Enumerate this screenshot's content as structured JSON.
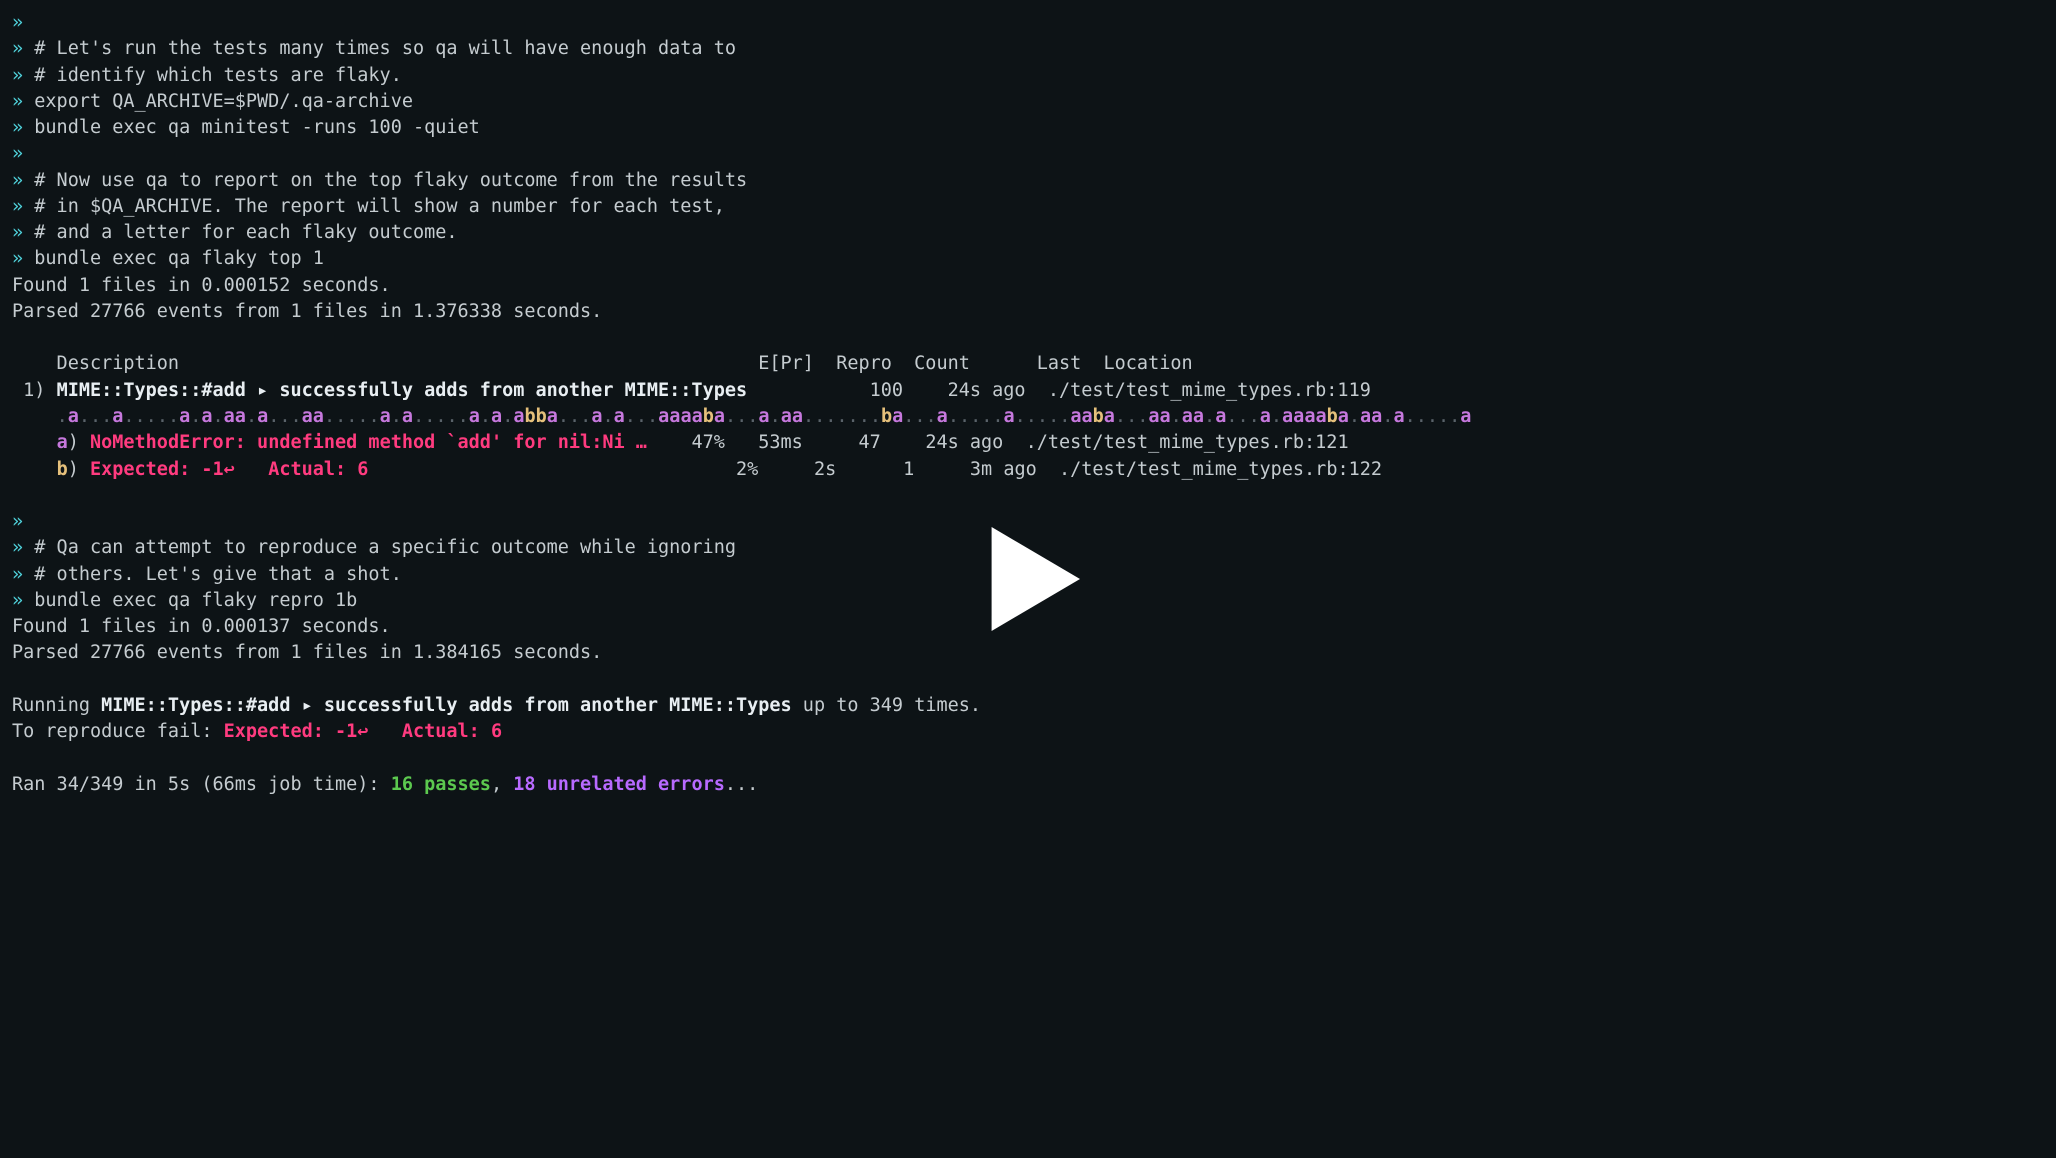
{
  "prompt": "»",
  "block1": {
    "blank0": "",
    "c1": "# Let's run the tests many times so qa will have enough data to",
    "c2": "# identify which tests are flaky.",
    "cmd1": "export QA_ARCHIVE=$PWD/.qa-archive",
    "cmd2": "bundle exec qa minitest -runs 100 -quiet",
    "blank1": "",
    "c3": "# Now use qa to report on the top flaky outcome from the results",
    "c4": "# in $QA_ARCHIVE. The report will show a number for each test,",
    "c5": "# and a letter for each flaky outcome.",
    "cmd3": "bundle exec qa flaky top 1"
  },
  "found1": "Found 1 files in 0.000152 seconds.",
  "parsed1": "Parsed 27766 events from 1 files in 1.376338 seconds.",
  "header": "    Description                                                    E[Pr]  Repro  Count      Last  Location",
  "row1": {
    "prefix": " 1) ",
    "desc": "MIME::Types::#add ▸ successfully adds from another MIME::Types",
    "tail": "           100    24s ago  ./test/test_mime_types.rb:119"
  },
  "pattern": {
    "pad": "    ",
    "segments": [
      ".",
      "a",
      ".",
      "..",
      "a",
      ".",
      "..",
      "..",
      "a",
      ".",
      "a",
      ".",
      "aa",
      ".",
      "a",
      ".",
      "..",
      "aa",
      ".",
      "..",
      "..",
      "a",
      ".",
      "a",
      ".",
      "..",
      "..",
      "a",
      ".",
      "a",
      ".",
      "ab",
      "ba",
      ".",
      "..",
      "a",
      ".",
      "a",
      ".",
      "..",
      "aa",
      "aa",
      "ba",
      ".",
      "..",
      "a",
      ".",
      "aa",
      ".",
      "..",
      "..",
      "..",
      "ba",
      ".",
      "..",
      "a",
      ".",
      "..",
      "..",
      "a",
      ".",
      "..",
      "..",
      "aa",
      "ba",
      ".",
      "..",
      "aa",
      ".",
      "aa",
      ".",
      "a",
      ".",
      "..",
      "a",
      ".",
      "aa",
      "aa",
      "ba",
      ".",
      "aa",
      ".",
      "a",
      ".",
      "..",
      "..",
      "a"
    ]
  },
  "rowA": {
    "pad": "    ",
    "label": "a",
    "sep": ") ",
    "msg": "NoMethodError: undefined method `add' for nil:Ni …",
    "tail": "    47%   53ms     47    24s ago  ./test/test_mime_types.rb:121"
  },
  "rowB": {
    "pad": "    ",
    "label": "b",
    "sep": ") ",
    "msg1": "Expected: -1↩",
    "gap": "   ",
    "msg2": "Actual: 6",
    "tail": "                                 2%     2s      1     3m ago  ./test/test_mime_types.rb:122"
  },
  "block2": {
    "blank0": "",
    "c1": "# Qa can attempt to reproduce a specific outcome while ignoring",
    "c2": "# others. Let's give that a shot.",
    "cmd1": "bundle exec qa flaky repro 1b"
  },
  "found2": "Found 1 files in 0.000137 seconds.",
  "parsed2": "Parsed 27766 events from 1 files in 1.384165 seconds.",
  "running": {
    "pre": "Running ",
    "desc": "MIME::Types::#add ▸ successfully adds from another MIME::Types",
    "post": " up to 349 times."
  },
  "repro": {
    "pre": "To reproduce fail: ",
    "msg1": "Expected: -1↩",
    "gap": "   ",
    "msg2": "Actual: 6"
  },
  "ran": {
    "pre": "Ran 34/349 in 5s (66ms job time): ",
    "passes": "16 passes",
    "sep": ", ",
    "errors": "18 unrelated errors",
    "ellipsis": "..."
  }
}
